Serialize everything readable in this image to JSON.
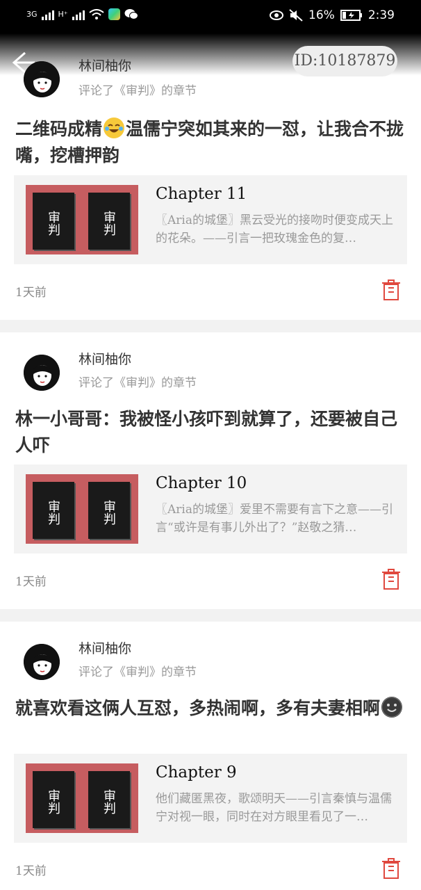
{
  "status_bar": {
    "net1": "3G",
    "net2": "H⁺",
    "battery_percent": "16%",
    "time": "2:39"
  },
  "header": {
    "id_badge": "ID:10187879"
  },
  "items": [
    {
      "user": "林间柚你",
      "action": "评论了《审判》的章节",
      "comment_before_emoji": "二维码成精",
      "comment_after_emoji": "温儒宁突如其来的一怼，让我合不拢嘴，挖槽押韵",
      "emoji": "laughing-tears-emoji",
      "chapter_title": "Chapter 11",
      "chapter_excerpt": "〖Aria的城堡〗黑云受光的接吻时便变成天上的花朵。——引言一把玫瑰金色的复…",
      "time": "1天前"
    },
    {
      "user": "林间柚你",
      "action": "评论了《审判》的章节",
      "comment": "林一小哥哥：我被怪小孩吓到就算了，还要被自己人吓",
      "chapter_title": "Chapter 10",
      "chapter_excerpt": "〖Aria的城堡〗爱里不需要有言下之意——引言“或许是有事儿外出了？”赵敬之猜…",
      "time": "1天前"
    },
    {
      "user": "林间柚你",
      "action": "评论了《审判》的章节",
      "comment": "就喜欢看这俩人互怼，多热闹啊，多有夫妻相啊",
      "emoji": "smiling-face-emoji",
      "chapter_title": "Chapter 9",
      "chapter_excerpt": "他们藏匿黑夜，歌颂明天——引言秦慎与温儒宁对视一眼，同时在对方眼里看见了一…",
      "time": "1天前"
    }
  ],
  "colors": {
    "trash_icon": "#e0483e",
    "cover_bg": "#c65d60"
  }
}
